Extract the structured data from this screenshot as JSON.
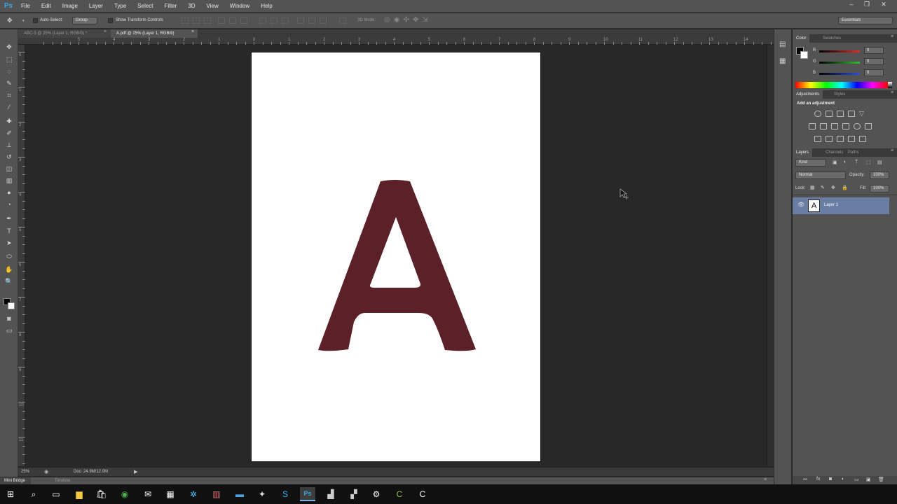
{
  "app": {
    "logo": "Ps"
  },
  "menu": [
    "File",
    "Edit",
    "Image",
    "Layer",
    "Type",
    "Select",
    "Filter",
    "3D",
    "View",
    "Window",
    "Help"
  ],
  "window_controls": {
    "minimize": "–",
    "maximize": "❐",
    "close": "✕"
  },
  "options": {
    "auto_select_label": "Auto-Select:",
    "auto_select_value": "Group",
    "transform_label": "Show Transform Controls",
    "mode_3d_label": "3D Mode:",
    "workspace": "Essentials"
  },
  "tabs": [
    {
      "label": "ABC-3 @ 25% (Layer 1, RGB/8) *",
      "active": false
    },
    {
      "label": "A.pdf @ 25% (Layer 1, RGB/8)",
      "active": true
    }
  ],
  "ruler_h_numbers": [
    "6",
    "5",
    "4",
    "3",
    "2",
    "1",
    "0",
    "1",
    "2",
    "3",
    "4",
    "5",
    "6",
    "7",
    "8",
    "9",
    "10",
    "11",
    "12",
    "13",
    "14"
  ],
  "ruler_v_numbers": [
    "0",
    "1",
    "2",
    "3",
    "4",
    "5",
    "6",
    "7",
    "8",
    "9",
    "10",
    "11"
  ],
  "status": {
    "zoom": "25%",
    "doc": "Doc: 24.9M/12.0M"
  },
  "bottom_tabs": [
    "Mini Bridge",
    "Timeline"
  ],
  "color_panel": {
    "tabs": [
      "Color",
      "Swatches"
    ],
    "channels": [
      {
        "label": "R",
        "value": "0",
        "color": "#e03030"
      },
      {
        "label": "G",
        "value": "0",
        "color": "#30c030"
      },
      {
        "label": "B",
        "value": "0",
        "color": "#3050e0"
      }
    ]
  },
  "adjustments_panel": {
    "tabs": [
      "Adjustments",
      "Styles"
    ],
    "heading": "Add an adjustment"
  },
  "layers_panel": {
    "tabs": [
      "Layers",
      "Channels",
      "Paths"
    ],
    "kind_label": "Kind",
    "blend_mode": "Normal",
    "opacity_label": "Opacity:",
    "opacity_value": "100%",
    "lock_label": "Lock:",
    "fill_label": "Fill:",
    "fill_value": "100%",
    "layers": [
      {
        "name": "Layer 1",
        "thumb": "A",
        "visible": true
      }
    ]
  },
  "document": {
    "glyph_color": "#5c2128"
  },
  "taskbar_icons": [
    "windows-icon",
    "search-icon",
    "task-view-icon",
    "file-explorer-icon",
    "store-icon",
    "chrome-icon",
    "mail-icon",
    "calendar-icon",
    "app-icon",
    "app2-icon",
    "app3-icon",
    "app4-icon",
    "skype-icon",
    "photoshop-icon",
    "app5-icon",
    "app6-icon",
    "settings-icon",
    "app7-icon",
    "app8-icon"
  ]
}
